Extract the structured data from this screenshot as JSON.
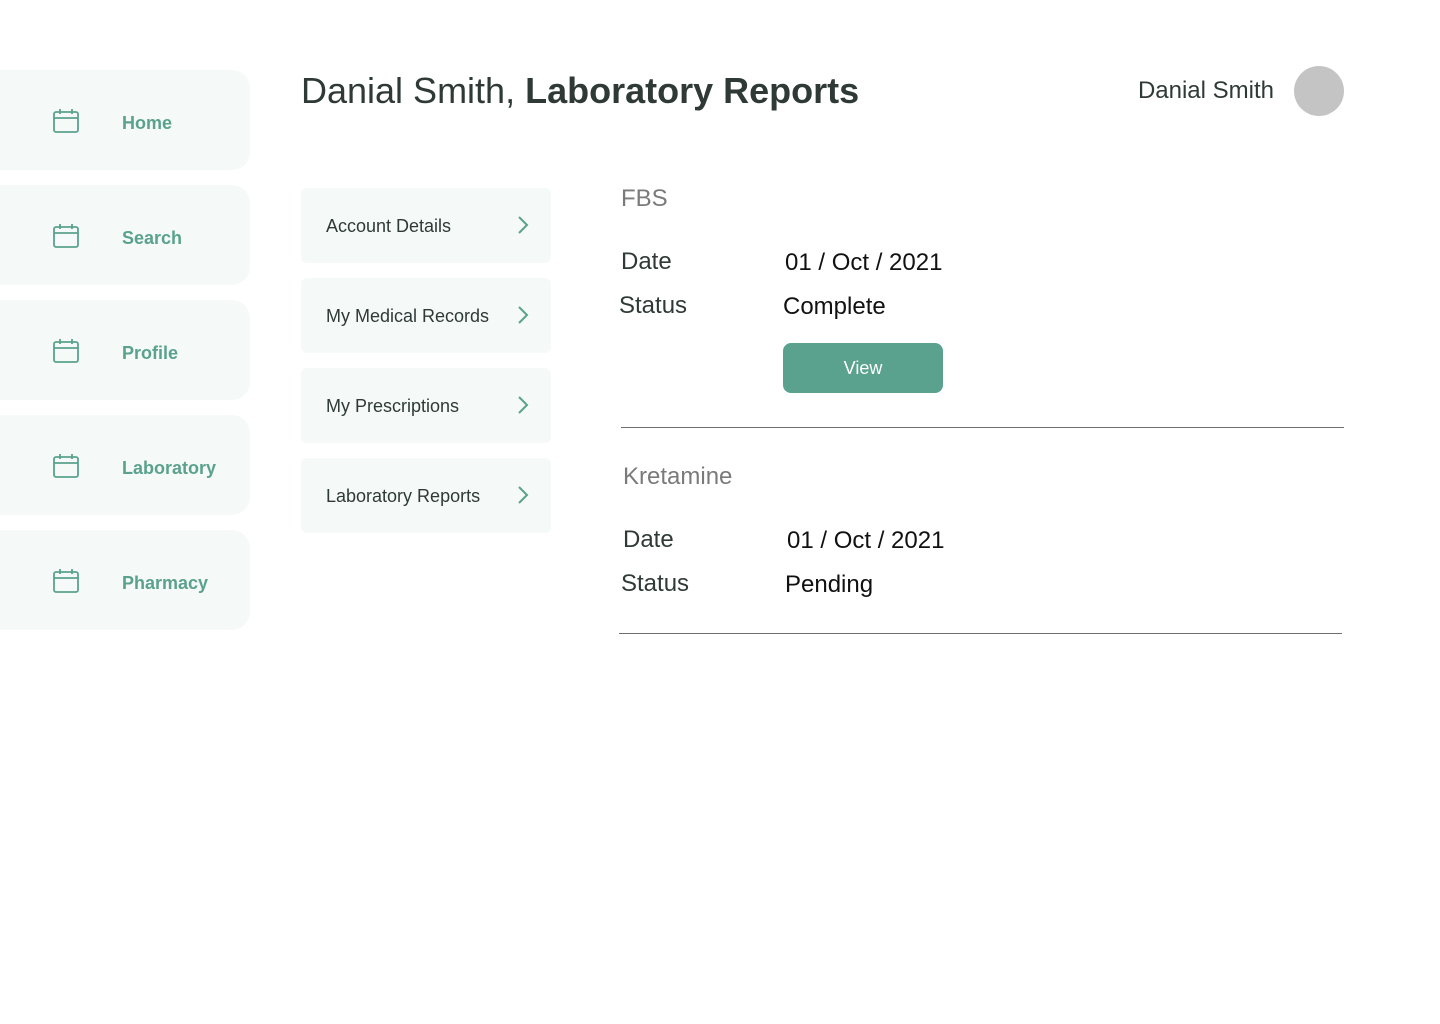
{
  "nav": {
    "items": [
      {
        "label": "Home",
        "icon": "calendar-icon"
      },
      {
        "label": "Search",
        "icon": "calendar-icon"
      },
      {
        "label": "Profile",
        "icon": "calendar-icon"
      },
      {
        "label": "Laboratory",
        "icon": "calendar-icon"
      },
      {
        "label": "Pharmacy",
        "icon": "calendar-icon"
      }
    ]
  },
  "header": {
    "patient_name": "Danial Smith,",
    "section_title": "Laboratory Reports",
    "user_name": "Danial Smith"
  },
  "submenu": {
    "items": [
      {
        "label": "Account Details",
        "icon": "chevron-right-icon"
      },
      {
        "label": "My Medical Records",
        "icon": "chevron-right-icon"
      },
      {
        "label": "My Prescriptions",
        "icon": "chevron-right-icon"
      },
      {
        "label": "Laboratory Reports",
        "icon": "chevron-right-icon"
      }
    ]
  },
  "reports": [
    {
      "name": "FBS",
      "date_label": "Date",
      "date_value": "01 / Oct / 2021",
      "status_label": "Status",
      "status_value": "Complete",
      "action_label": "View"
    },
    {
      "name": "Kretamine",
      "date_label": "Date",
      "date_value": "01 / Oct / 2021",
      "status_label": "Status",
      "status_value": "Pending"
    }
  ],
  "colors": {
    "accent": "#5aa28d",
    "panel": "#f5f9f8",
    "text": "#2f3a37",
    "muted": "#7a7a7a",
    "avatar": "#c4c4c4"
  }
}
